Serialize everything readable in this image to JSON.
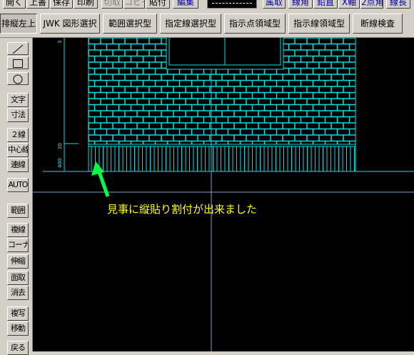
{
  "toolbar_top": {
    "buttons": [
      "開く",
      "上書",
      "保存",
      "印刷",
      "切取",
      "コピー",
      "貼付",
      "編集"
    ],
    "right_buttons": [
      "属取",
      "線角",
      "鉛直",
      "X軸",
      "2点角",
      "線長"
    ]
  },
  "toolbar_second": {
    "buttons": [
      "排縦左上",
      "JWK 図形選択",
      "範囲選択型",
      "指定線選択型",
      "指示点領域型",
      "指示線領域型",
      "断線検査"
    ]
  },
  "left_toolbar": {
    "tools": [
      "文字",
      "寸法",
      "２線",
      "中心線",
      "連線",
      "AUTO",
      "範囲",
      "複線",
      "コーナー",
      "伸縮",
      "面取",
      "消去",
      "複写",
      "移動",
      "戻る"
    ]
  },
  "drawing": {
    "dimension_labels": [
      "400",
      "20",
      "3"
    ],
    "annotation": "見事に縦貼り割付が出来ました",
    "colors": {
      "line": "#00e0e0",
      "arrow": "#00ff40",
      "text": "#ffff00",
      "guide": "#7fa0c0"
    }
  }
}
